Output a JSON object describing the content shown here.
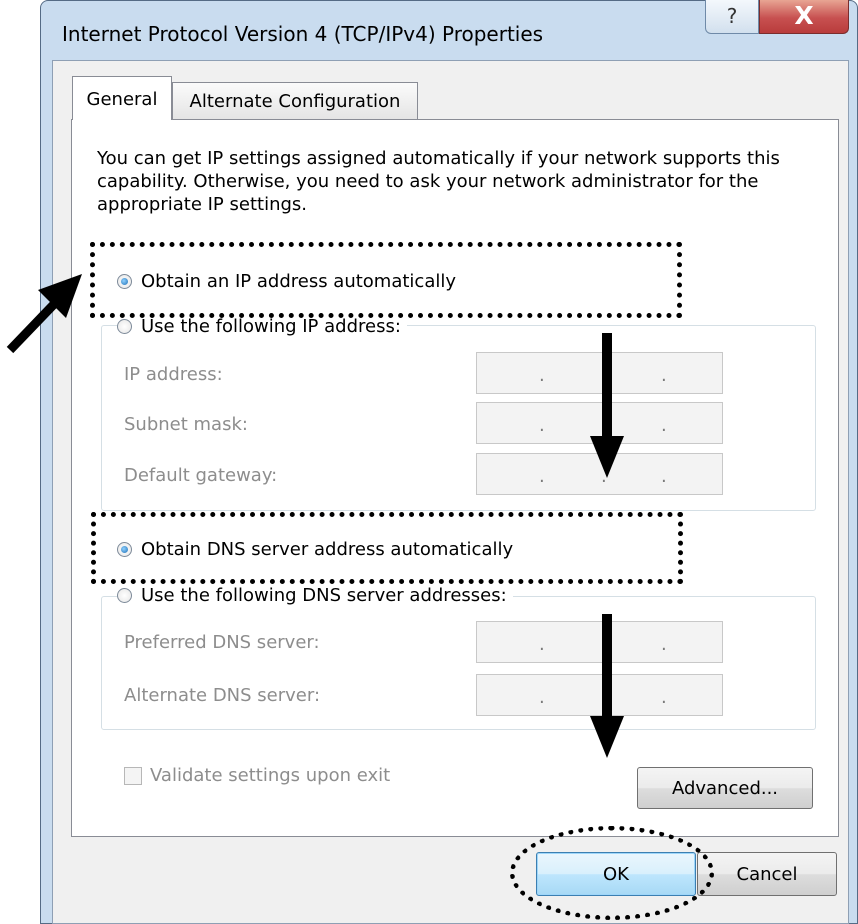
{
  "window": {
    "title": "Internet Protocol Version 4 (TCP/IPv4) Properties",
    "help_label": "?",
    "close_label": "X"
  },
  "tabs": [
    {
      "label": "General",
      "active": true
    },
    {
      "label": "Alternate Configuration",
      "active": false
    }
  ],
  "intro_text": "You can get IP settings assigned automatically if your network supports this capability. Otherwise, you need to ask your network administrator for the appropriate IP settings.",
  "ip_section": {
    "auto_label": "Obtain an IP address automatically",
    "auto_checked": true,
    "manual_label": "Use the following IP address:",
    "fields": [
      {
        "label": "IP address:",
        "value": ". . ."
      },
      {
        "label": "Subnet mask:",
        "value": ". . ."
      },
      {
        "label": "Default gateway:",
        "value": ". . ."
      }
    ]
  },
  "dns_section": {
    "auto_label": "Obtain DNS server address automatically",
    "auto_checked": true,
    "manual_label": "Use the following DNS server addresses:",
    "fields": [
      {
        "label": "Preferred DNS server:",
        "value": ". . ."
      },
      {
        "label": "Alternate DNS server:",
        "value": ". . ."
      }
    ]
  },
  "validate": {
    "label": "Validate settings upon exit",
    "checked": false
  },
  "buttons": {
    "advanced": "Advanced...",
    "ok": "OK",
    "cancel": "Cancel"
  },
  "colors": {
    "title_bar": "#c9dcef",
    "close_button": "#c75050",
    "radio_dot": "#1f6fb5"
  }
}
